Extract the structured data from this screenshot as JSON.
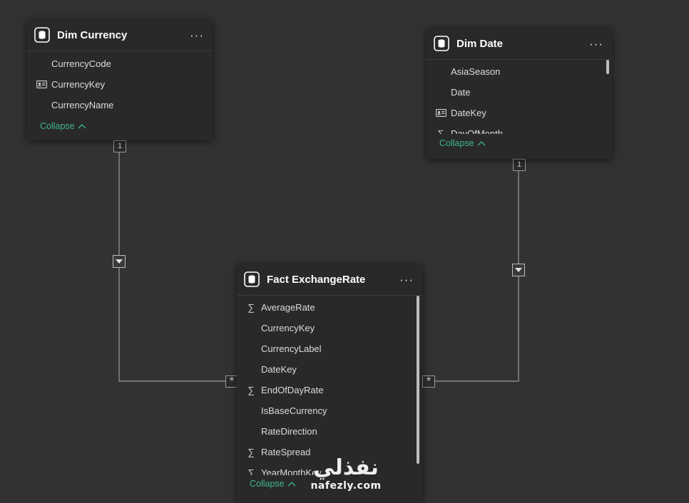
{
  "colors": {
    "background": "#323232",
    "card": "#292929",
    "accent": "#3fb68b",
    "line": "#9a9a9a"
  },
  "tables": {
    "dim_currency": {
      "title": "Dim Currency",
      "icon": "table-icon",
      "more": "···",
      "fields": [
        {
          "label": "CurrencyCode",
          "icon": ""
        },
        {
          "label": "CurrencyKey",
          "icon": "id-card-icon"
        },
        {
          "label": "CurrencyName",
          "icon": ""
        }
      ],
      "collapse": "Collapse"
    },
    "dim_date": {
      "title": "Dim Date",
      "icon": "table-icon",
      "more": "···",
      "fields": [
        {
          "label": "AsiaSeason",
          "icon": ""
        },
        {
          "label": "Date",
          "icon": ""
        },
        {
          "label": "DateKey",
          "icon": "id-card-icon"
        },
        {
          "label": "DayOfMonth",
          "icon": "sigma-icon"
        }
      ],
      "collapse": "Collapse"
    },
    "fact_exchange_rate": {
      "title": "Fact ExchangeRate",
      "icon": "table-icon",
      "more": "···",
      "fields": [
        {
          "label": "AverageRate",
          "icon": "sigma-icon"
        },
        {
          "label": "CurrencyKey",
          "icon": ""
        },
        {
          "label": "CurrencyLabel",
          "icon": ""
        },
        {
          "label": "DateKey",
          "icon": ""
        },
        {
          "label": "EndOfDayRate",
          "icon": "sigma-icon"
        },
        {
          "label": "IsBaseCurrency",
          "icon": ""
        },
        {
          "label": "RateDirection",
          "icon": ""
        },
        {
          "label": "RateSpread",
          "icon": "sigma-icon"
        },
        {
          "label": "YearMonthKey",
          "icon": "sigma-icon"
        }
      ],
      "collapse": "Collapse"
    }
  },
  "relationships": {
    "currency_to_fact": {
      "from_cardinality": "1",
      "to_cardinality": "*",
      "direction": "single"
    },
    "date_to_fact": {
      "from_cardinality": "1",
      "to_cardinality": "*",
      "direction": "single"
    }
  },
  "watermark": {
    "arabic": "نفذلي",
    "latin": "nafezly.com"
  }
}
